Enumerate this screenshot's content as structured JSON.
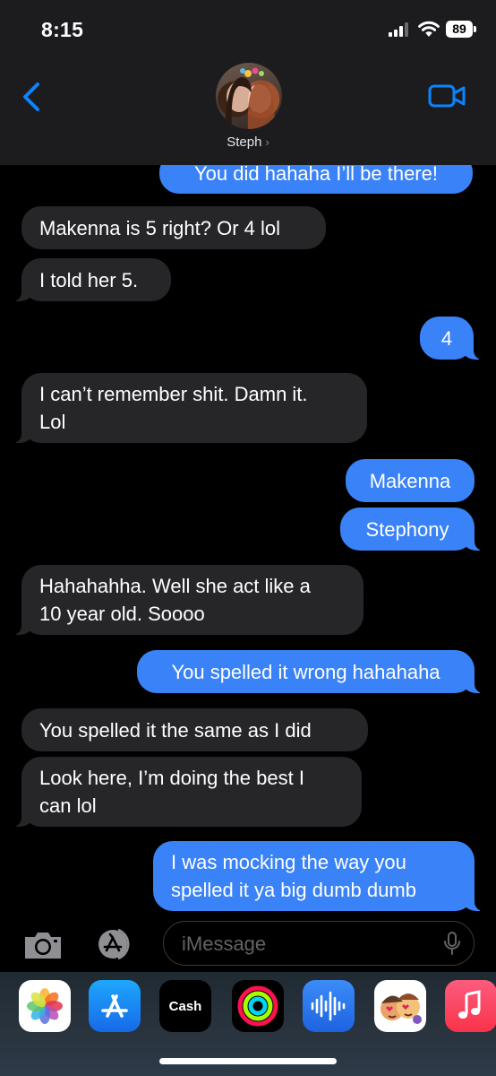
{
  "status_bar": {
    "time": "8:15",
    "battery": "89"
  },
  "header": {
    "contact_name": "Steph",
    "chevron": "›"
  },
  "messages": [
    {
      "side": "out",
      "text": "You did hahaha I’ll be there!"
    },
    {
      "side": "in",
      "text": "Makenna is 5 right? Or 4 lol"
    },
    {
      "side": "in",
      "text": "I told her 5."
    },
    {
      "side": "out",
      "text": "4"
    },
    {
      "side": "in",
      "text": "I can’t remember shit. Damn it.\nLol"
    },
    {
      "side": "out",
      "text": "Makenna"
    },
    {
      "side": "out",
      "text": "Stephony"
    },
    {
      "side": "in",
      "text": "Hahahahha. Well she act like a\n10 year old. Soooo"
    },
    {
      "side": "out",
      "text": "You spelled it wrong hahahaha"
    },
    {
      "side": "in",
      "text": "You spelled it the same as I did"
    },
    {
      "side": "in",
      "text": "Look here, I’m doing the best I\ncan lol"
    },
    {
      "side": "out",
      "text": "I was mocking the way you\nspelled it ya big dumb dumb"
    }
  ],
  "input": {
    "placeholder": "iMessage"
  },
  "app_drawer": {
    "apps": [
      "photos-icon",
      "app-store-icon",
      "apple-cash-icon",
      "fitness-icon",
      "audio-message-icon",
      "memoji-icon",
      "music-icon"
    ],
    "cash_label": "Cash"
  },
  "colors": {
    "outgoing": "#3a82f7",
    "incoming": "#262629",
    "accent": "#0a84ff"
  }
}
